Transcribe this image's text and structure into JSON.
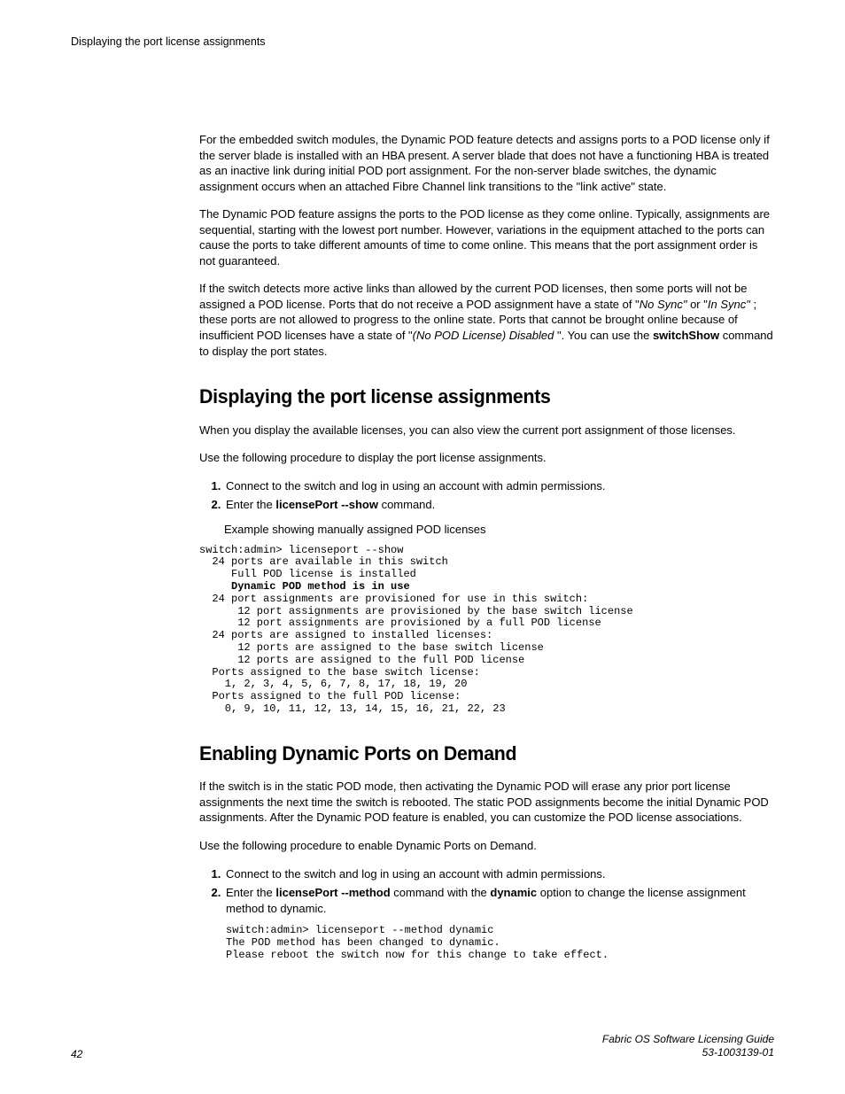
{
  "running_header": "Displaying the port license assignments",
  "intro": {
    "p1_a": "For the embedded switch modules, the Dynamic POD feature detects and assigns ports to a POD license only if the server blade is installed with an HBA present. A server blade that does not have a functioning HBA is treated as an inactive link during initial POD port assignment. For the non-server blade switches, the dynamic assignment occurs when an attached Fibre Channel link transitions to the \"link active\" state.",
    "p2": "The Dynamic POD feature assigns the ports to the POD license as they come online. Typically, assignments are sequential, starting with the lowest port number. However, variations in the equipment attached to the ports can cause the ports to take different amounts of time to come online. This means that the port assignment order is not guaranteed.",
    "p3_a": "If the switch detects more active links than allowed by the current POD licenses, then some ports will not be assigned a POD license. Ports that do not receive a POD assignment have a state of \"",
    "p3_nosync": "No Sync\"",
    "p3_b": " or \"",
    "p3_insync": "In Sync\"",
    "p3_c": " ; these ports are not allowed to progress to the online state. Ports that cannot be brought online because of insufficient POD licenses have a state of \"",
    "p3_disabled": "(No POD License) Disabled",
    "p3_d": " \". You can use the ",
    "p3_cmd": "switchShow",
    "p3_e": " command to display the port states."
  },
  "section1": {
    "heading": "Displaying the port license assignments",
    "p1": "When you display the available licenses, you can also view the current port assignment of those licenses.",
    "p2": "Use the following procedure to display the port license assignments.",
    "step1": "Connect to the switch and log in using an account with admin permissions.",
    "step2_a": "Enter the ",
    "step2_cmd": "licensePort --show",
    "step2_b": " command.",
    "example_label": "Example showing manually assigned POD licenses",
    "code_plain1": "switch:admin> licenseport --show\n  24 ports are available in this switch\n     Full POD license is installed\n     ",
    "code_bold": "Dynamic POD method is in use",
    "code_plain2": "\n  24 port assignments are provisioned for use in this switch:\n      12 port assignments are provisioned by the base switch license\n      12 port assignments are provisioned by a full POD license\n  24 ports are assigned to installed licenses:\n      12 ports are assigned to the base switch license\n      12 ports are assigned to the full POD license\n  Ports assigned to the base switch license:\n    1, 2, 3, 4, 5, 6, 7, 8, 17, 18, 19, 20\n  Ports assigned to the full POD license:\n    0, 9, 10, 11, 12, 13, 14, 15, 16, 21, 22, 23"
  },
  "section2": {
    "heading": "Enabling Dynamic Ports on Demand",
    "p1": "If the switch is in the static POD mode, then activating the Dynamic POD will erase any prior port license assignments the next time the switch is rebooted. The static POD assignments become the initial Dynamic POD assignments. After the Dynamic POD feature is enabled, you can customize the POD license associations.",
    "p2": "Use the following procedure to enable Dynamic Ports on Demand.",
    "step1": "Connect to the switch and log in using an account with admin permissions.",
    "step2_a": "Enter the ",
    "step2_cmd": "licensePort --method",
    "step2_b": " command with the ",
    "step2_opt": "dynamic",
    "step2_c": " option to change the license assignment method to dynamic.",
    "code": "switch:admin> licenseport --method dynamic\nThe POD method has been changed to dynamic.\nPlease reboot the switch now for this change to take effect."
  },
  "footer": {
    "page": "42",
    "title": "Fabric OS Software Licensing Guide",
    "docnum": "53-1003139-01"
  }
}
